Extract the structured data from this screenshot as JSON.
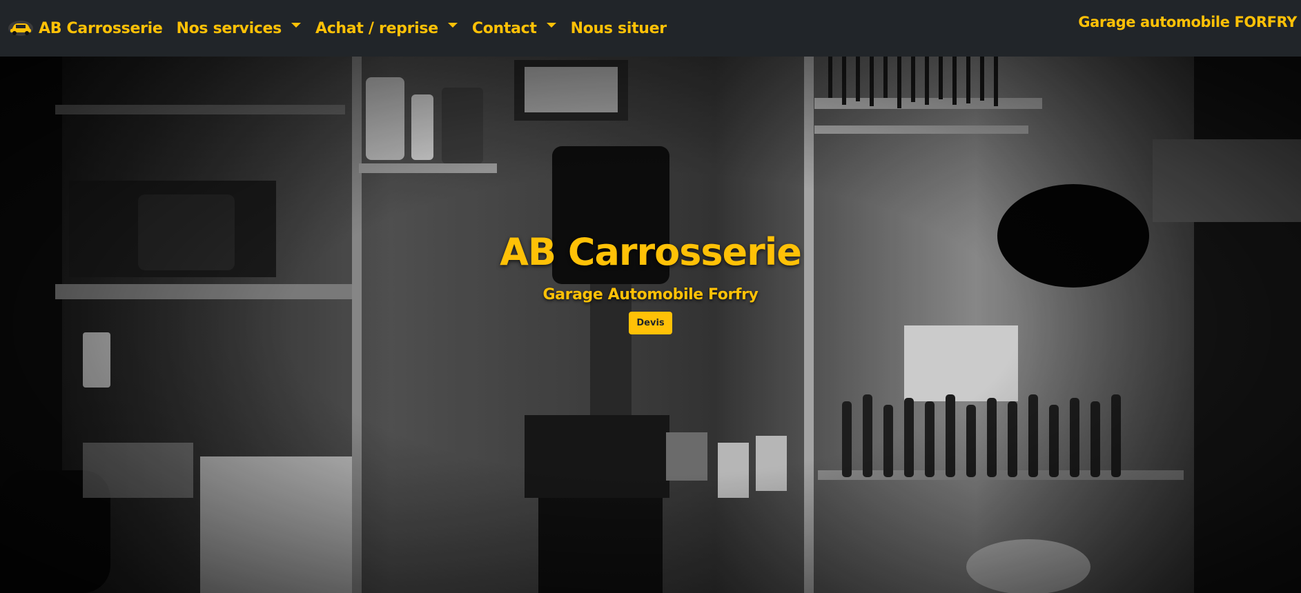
{
  "navbar": {
    "brand_name": "AB Carrosserie",
    "brand_logo_icon": "car-icon",
    "items": [
      {
        "label": "Nos services",
        "dropdown": true
      },
      {
        "label": "Achat / reprise",
        "dropdown": true
      },
      {
        "label": "Contact",
        "dropdown": true
      },
      {
        "label": "Nous situer",
        "dropdown": false
      }
    ],
    "right_text": "Garage automobile FORFRY"
  },
  "hero": {
    "title": "AB Carrosserie",
    "subtitle": "Garage Automobile Forfry",
    "button_label": "Devis"
  },
  "colors": {
    "accent": "#ffc107",
    "navbar_bg": "#212529",
    "button_text": "#212529"
  }
}
